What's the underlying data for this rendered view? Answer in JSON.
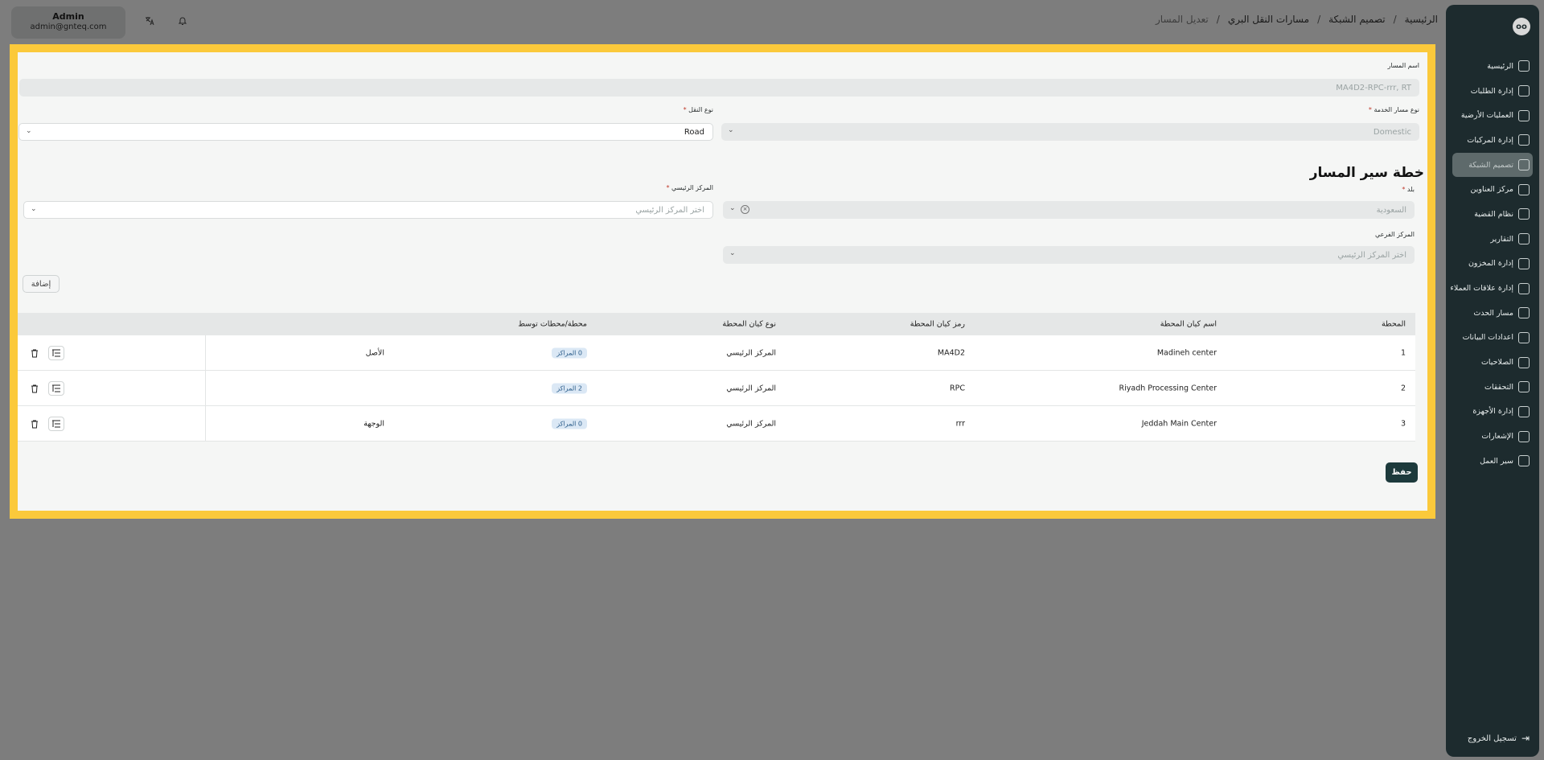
{
  "header": {
    "user_name": "Admin",
    "user_email": "admin@gnteq.com",
    "translate_icon": "translate-icon",
    "bell_icon": "bell-icon",
    "breadcrumbs": [
      "الرئيسية",
      "تصميم الشبكة",
      "مسارات النقل البري",
      "تعديل المسار"
    ]
  },
  "sidebar": {
    "logo_text": "oo",
    "items": [
      {
        "label": "الرئيسية",
        "icon": "home-icon"
      },
      {
        "label": "إدارة الطلبات",
        "icon": "orders-icon"
      },
      {
        "label": "العمليات الأرضية",
        "icon": "operations-icon"
      },
      {
        "label": "إدارة المركبات",
        "icon": "truck-icon"
      },
      {
        "label": "تصميم الشبكة",
        "icon": "network-icon"
      },
      {
        "label": "مركز العناوين",
        "icon": "location-icon"
      },
      {
        "label": "نظام القضية",
        "icon": "case-icon"
      },
      {
        "label": "التقارير",
        "icon": "reports-icon"
      },
      {
        "label": "إدارة المخزون",
        "icon": "inventory-icon"
      },
      {
        "label": "إدارة علاقات العملاء",
        "icon": "crm-icon"
      },
      {
        "label": "مسار الحدث",
        "icon": "event-path-icon"
      },
      {
        "label": "اعدادات البيانات",
        "icon": "database-icon"
      },
      {
        "label": "الصلاحيات",
        "icon": "users-icon"
      },
      {
        "label": "التحققات",
        "icon": "tools-icon"
      },
      {
        "label": "إدارة الأجهزة",
        "icon": "device-icon"
      },
      {
        "label": "الإشعارات",
        "icon": "bell-icon"
      },
      {
        "label": "سير العمل",
        "icon": "workflow-icon"
      }
    ],
    "active_index": 4,
    "logout_label": "تسجيل الخروج"
  },
  "form": {
    "route_name_label": "اسم المسار",
    "route_name_value": "MA4D2-RPC-rrr, RT",
    "service_type_label": "نوع مسار الخدمة",
    "service_type_value": "Domestic",
    "transport_type_label": "نوع النقل",
    "transport_type_value": "Road",
    "section_title": "خطة سير المسار",
    "country_label": "بلد",
    "country_value": "السعودية",
    "main_center_label": "المركز الرئيسي",
    "main_center_placeholder": "اختر المركز الرئيسي",
    "sub_center_label": "المركز الفرعي",
    "sub_center_placeholder": "اختر المركز الرئيسي",
    "add_button": "إضافة",
    "required_mark": "*"
  },
  "table": {
    "headers": {
      "station": "المحطة",
      "entity_name": "اسم كيان المحطة",
      "entity_code": "رمز كيان المحطة",
      "entity_type": "نوع كيان المحطة",
      "intermediate": "محطة/محطات توسط"
    },
    "rows": [
      {
        "num": "1",
        "name": "Madineh center",
        "code": "MA4D2",
        "type": "المركز الرئيسي",
        "badge": "0 المراكز",
        "role": "الأصل"
      },
      {
        "num": "2",
        "name": "Riyadh Processing Center",
        "code": "RPC",
        "type": "المركز الرئيسي",
        "badge": "2 المراكز",
        "role": ""
      },
      {
        "num": "3",
        "name": "Jeddah Main Center",
        "code": "rrr",
        "type": "المركز الرئيسي",
        "badge": "0 المراكز",
        "role": "الوجهة"
      }
    ]
  },
  "save_button": "حفظ"
}
